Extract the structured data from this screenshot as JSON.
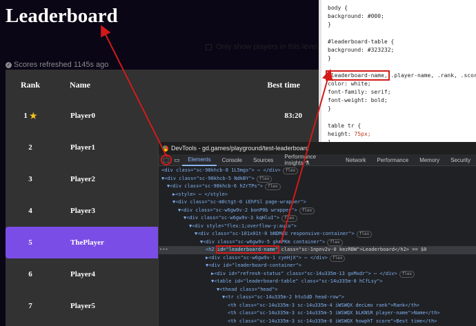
{
  "game": {
    "title": "Leaderboard",
    "refresh_status": "Scores refreshed 1145s ago",
    "overlay_checkbox_label": "Only show players in this level",
    "headers": {
      "rank": "Rank",
      "name": "Name",
      "score": "Best time"
    },
    "rows": [
      {
        "rank": "1",
        "name": "Player0",
        "score": "83:20",
        "star": true
      },
      {
        "rank": "2",
        "name": "Player1",
        "score": ""
      },
      {
        "rank": "3",
        "name": "Player2",
        "score": ""
      },
      {
        "rank": "4",
        "name": "Player3",
        "score": ""
      },
      {
        "rank": "5",
        "name": "ThePlayer",
        "score": "",
        "active": true
      },
      {
        "rank": "6",
        "name": "Player4",
        "score": ""
      },
      {
        "rank": "7",
        "name": "Player5",
        "score": ""
      }
    ]
  },
  "css_panel": {
    "rule1_selector": "body {",
    "rule1_prop": "background: #000;",
    "rule1_close": "}",
    "rule2_selector": "#leaderboard-table {",
    "rule2_prop": "background: #323232;",
    "rule2_close": "}",
    "rule3_selector_highlight": "#leaderboard-name,",
    "rule3_selector_rest": " .player-name, .rank, .score {",
    "rule3_props": [
      "color: white;",
      "font-family: serif;",
      "font-weight: bold;"
    ],
    "rule3_close": "}",
    "rule4_selector": "table tr {",
    "rule4_prop": "height: 75px;",
    "rule4_close": "}"
  },
  "devtools": {
    "window_title": "DevTools - gd.games/playground/test-leaderboard",
    "tabs": [
      "Elements",
      "Console",
      "Sources",
      "Performance insights ⚗",
      "Network",
      "Performance",
      "Memory",
      "Security"
    ],
    "active_tab": "Elements",
    "dom_lines": [
      {
        "indent": 5,
        "text": "<div class=\"sc-98khcb-8 1L5mgs\"> ⋯ </div>",
        "pill": "flex"
      },
      {
        "indent": 5,
        "text": "▼<div class=\"sc-98khcb-5 NdkBY\">",
        "pill": "flex"
      },
      {
        "indent": 6,
        "text": "▼<div class=\"sc-98khcb-6 hZrTPs\">",
        "pill": "flex"
      },
      {
        "indent": 7,
        "text": "▶<style> ⋯ </style>",
        "pill": ""
      },
      {
        "indent": 7,
        "text": "▼<div class=\"sc-m0ctgt-0 iEhFSl page-wrapper\">",
        "pill": ""
      },
      {
        "indent": 8,
        "text": "▼<div class=\"sc-w6gw9v-2 bonP0b wrapper\">",
        "pill": "flex"
      },
      {
        "indent": 9,
        "text": "▼<div class=\"sc-w6gw9v-3 kqHluI\">",
        "pill": "flex"
      },
      {
        "indent": 10,
        "text": "▼<div style=\"flex:1;overflow-y:auto\">",
        "pill": ""
      },
      {
        "indent": 11,
        "text": "▼<div class=\"sc-101x01t-0 bNDMAU responsive-container\">",
        "pill": "flex"
      },
      {
        "indent": 12,
        "text": "▼<div class=\"sc-w6gw9v-5 gkmPKm container\">",
        "pill": "flex"
      },
      {
        "indent": 13,
        "text": "",
        "selected": true
      },
      {
        "indent": 13,
        "text": "▶<div class=\"sc-w6gw9v-1 cyeHjX\"> ⋯ </div>",
        "pill": "flex"
      },
      {
        "indent": 13,
        "text": "▼<div id=\"leaderboard-container\">",
        "pill": ""
      },
      {
        "indent": 14,
        "text": "▶<div id=\"refresh-status\" class=\"sc-14u335m-13 gxMxdr\"> ⋯ </div>",
        "pill": "flex"
      },
      {
        "indent": 14,
        "text": "▼<table id=\"leaderboard-table\" class=\"sc-14u335m-0 hCfLsy\">",
        "pill": ""
      },
      {
        "indent": 15,
        "text": "▼<thead class=\"head\">",
        "pill": ""
      },
      {
        "indent": 16,
        "text": "▼<tr class=\"sc-14u335m-2 htuSdD head-row\">",
        "pill": ""
      },
      {
        "indent": 17,
        "text": "<th class=\"sc-14u335m-3 sc-14u335m-4 iWSWQX decLmo rank\">Rank</th>",
        "pill": ""
      },
      {
        "indent": 17,
        "text": "<th class=\"sc-14u335m-3 sc-14u335m-5 iWSWQX bLKNSR player-name\">Name</th>",
        "pill": ""
      },
      {
        "indent": 17,
        "text": "<th class=\"sc-14u335m-3 sc-14u335m-6 iWSWQX howphT score\">Best time</th>",
        "pill": ""
      },
      {
        "indent": 16,
        "text": "</tr>",
        "pill": ""
      }
    ],
    "selected_line": {
      "pre": "<h2 ",
      "id_attr": "id=\"leaderboard-name\"",
      "post": " class=\"sc-1npnv2v-0 kezRBW\">Leaderboard</h2> == $0"
    }
  },
  "colors": {
    "page_bg": "#000000",
    "table_bg": "#323232",
    "active_row": "#7a4de6",
    "annotation": "#d21a1a",
    "star": "#f7c419"
  }
}
